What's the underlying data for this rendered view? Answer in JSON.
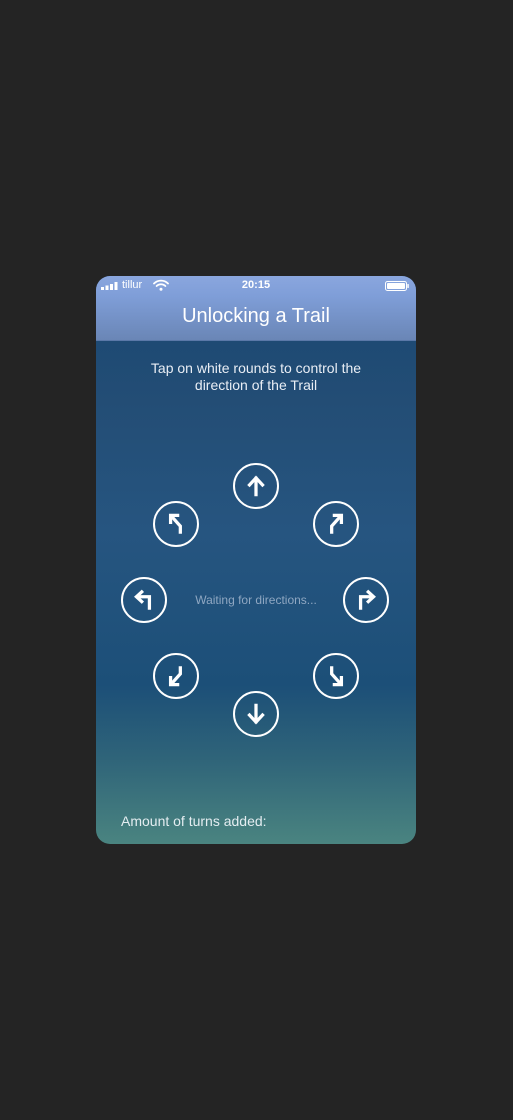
{
  "status_bar": {
    "carrier": "tillur",
    "time": "20:15"
  },
  "nav": {
    "title": "Unlocking a Trail"
  },
  "instruction": "Tap on white rounds to control the direction of the Trail",
  "controls": {
    "waiting_text": "Waiting for directions...",
    "buttons": [
      {
        "direction": "up",
        "icon": "arrow-up-icon"
      },
      {
        "direction": "up-left",
        "icon": "turn-up-left-icon"
      },
      {
        "direction": "up-right",
        "icon": "turn-up-right-icon"
      },
      {
        "direction": "left",
        "icon": "turn-left-icon"
      },
      {
        "direction": "right",
        "icon": "turn-right-icon"
      },
      {
        "direction": "down-left",
        "icon": "turn-down-left-icon"
      },
      {
        "direction": "down-right",
        "icon": "turn-down-right-icon"
      },
      {
        "direction": "down",
        "icon": "arrow-down-icon"
      }
    ]
  },
  "footer": {
    "turns_label": "Amount of turns added:"
  },
  "colors": {
    "background": "#242424",
    "status_bar": "#8aa6de",
    "nav_bar": "#7f9ed8",
    "panel_top": "#184773",
    "panel_bottom": "#4a8480",
    "button_outline": "#ffffff",
    "waiting_text": "#8fa7c2"
  }
}
